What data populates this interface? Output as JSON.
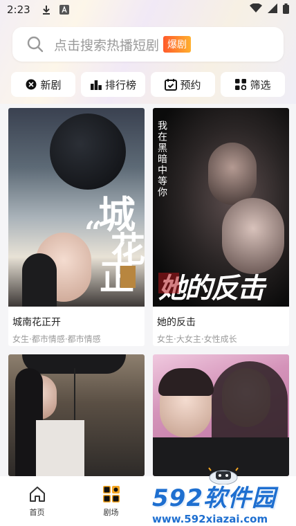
{
  "status_bar": {
    "time": "2:23"
  },
  "search": {
    "placeholder": "点击搜索热播短剧",
    "badge": "爆剧"
  },
  "chips": [
    {
      "label": "新剧",
      "icon": "new-icon"
    },
    {
      "label": "排行榜",
      "icon": "ranking-icon"
    },
    {
      "label": "预约",
      "icon": "calendar-icon"
    },
    {
      "label": "筛选",
      "icon": "filter-icon"
    }
  ],
  "cards": [
    {
      "title": "城南花正开",
      "tags": "女生·都市情感·都市情感",
      "poster_big_text_1": "城",
      "poster_big_text_2": "花",
      "poster_big_text_3": "正",
      "poster_quote": "“"
    },
    {
      "title": "她的反击",
      "tags": "女生·大女主·女性成长",
      "poster_vertical_text": "我在黑暗中等你",
      "poster_big_text": "她的反击"
    },
    {
      "title": "",
      "tags": ""
    },
    {
      "title": "",
      "tags": ""
    }
  ],
  "bottom_nav": {
    "items": [
      {
        "label": "首页",
        "icon": "home-icon"
      },
      {
        "label": "剧场",
        "icon": "theater-icon"
      }
    ]
  },
  "watermark": {
    "main": "592软件园",
    "url": "www.592xiazai.com"
  },
  "colors": {
    "accent": "#f5a623",
    "badge_start": "#ff5a2b",
    "badge_end": "#ffb02e",
    "watermark": "#1e6fd0"
  }
}
